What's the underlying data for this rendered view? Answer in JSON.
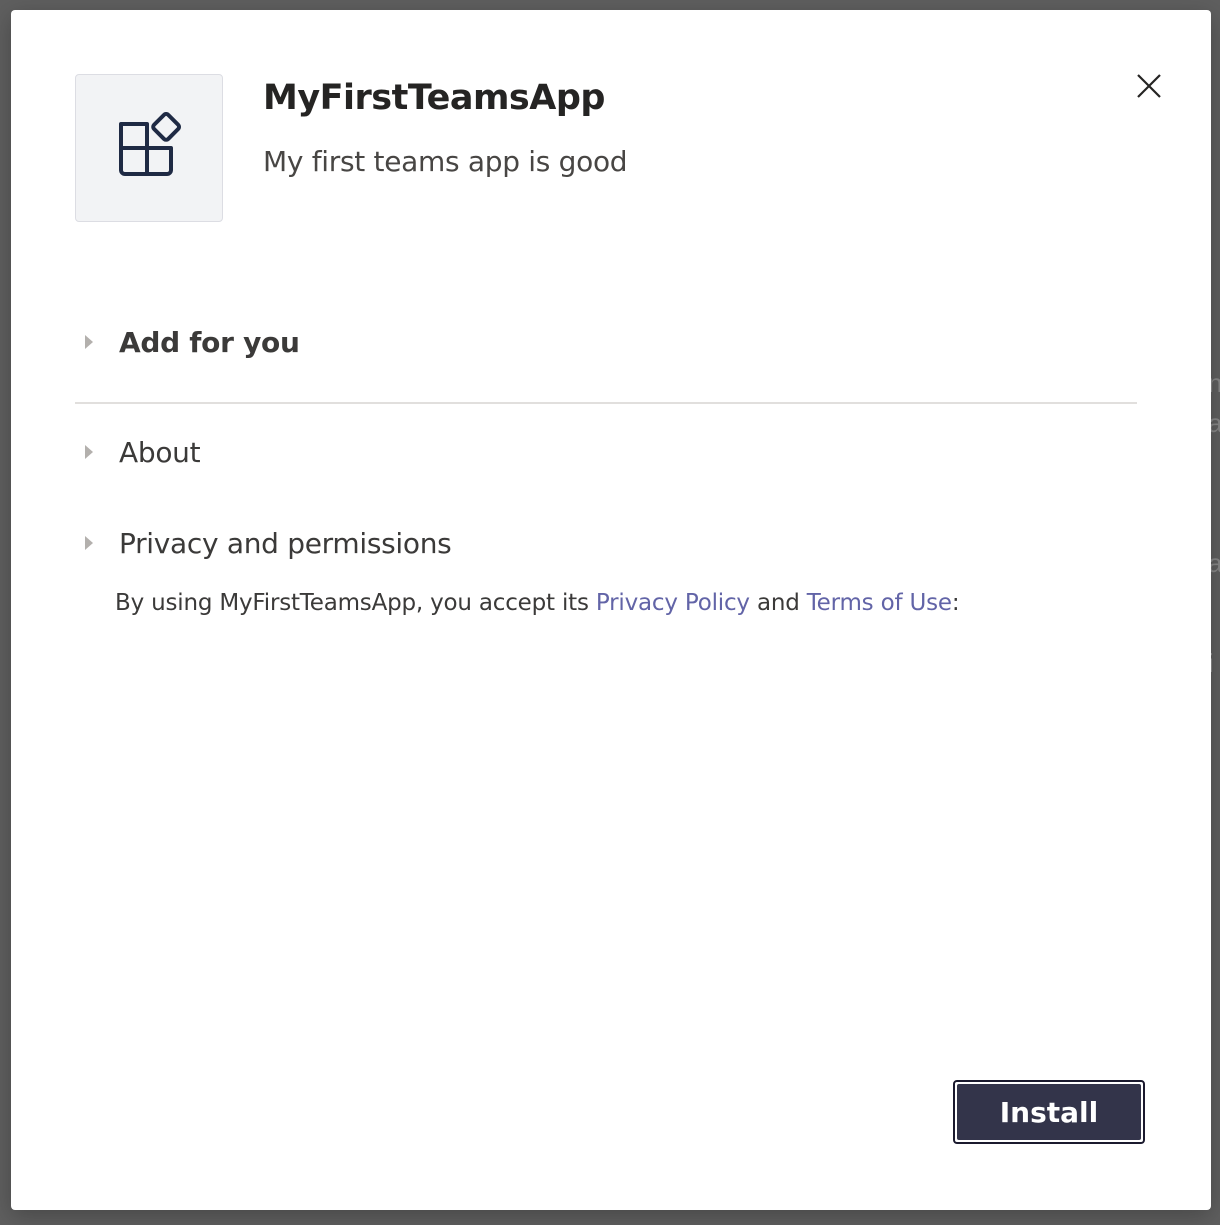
{
  "app": {
    "title": "MyFirstTeamsApp",
    "subtitle": "My first teams app is good",
    "icon": "app-tile-icon"
  },
  "sections": {
    "add_for_you": "Add for you",
    "about": "About",
    "privacy": "Privacy and permissions"
  },
  "consent": {
    "prefix": "By using MyFirstTeamsApp, you accept its ",
    "privacy_link": "Privacy Policy",
    "middle": " and ",
    "terms_link": "Terms of Use",
    "suffix": ":"
  },
  "actions": {
    "install_label": "Install",
    "close_icon": "close-icon"
  },
  "colors": {
    "primary": "#33344a",
    "link": "#6264a7",
    "overlay": "#5f5f5f"
  }
}
